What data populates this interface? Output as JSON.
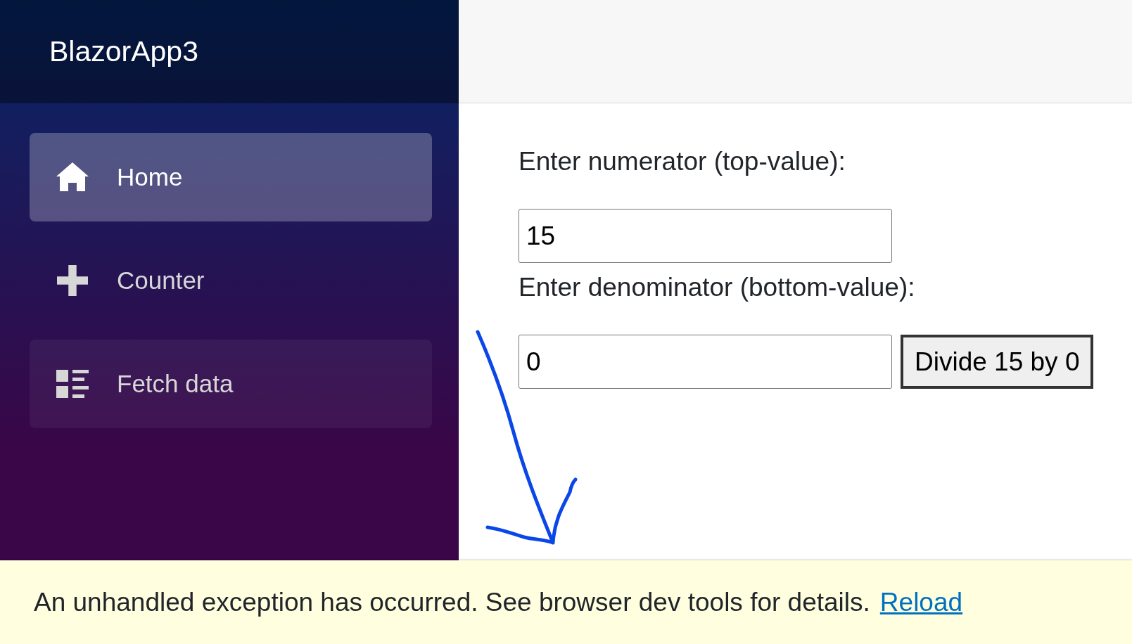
{
  "sidebar": {
    "brand": "BlazorApp3",
    "items": [
      {
        "label": "Home",
        "selected": true,
        "hovered": false
      },
      {
        "label": "Counter",
        "selected": false,
        "hovered": false
      },
      {
        "label": "Fetch data",
        "selected": false,
        "hovered": true
      }
    ]
  },
  "form": {
    "numerator_label": "Enter numerator (top-value):",
    "numerator_value": "15",
    "denominator_label": "Enter denominator (bottom-value):",
    "denominator_value": "0",
    "button": "Divide 15 by 0"
  },
  "annotation": {
    "kind": "arrow"
  },
  "error_bar": {
    "message": "An unhandled exception has occurred. See browser dev tools for details.",
    "link": "Reload"
  }
}
